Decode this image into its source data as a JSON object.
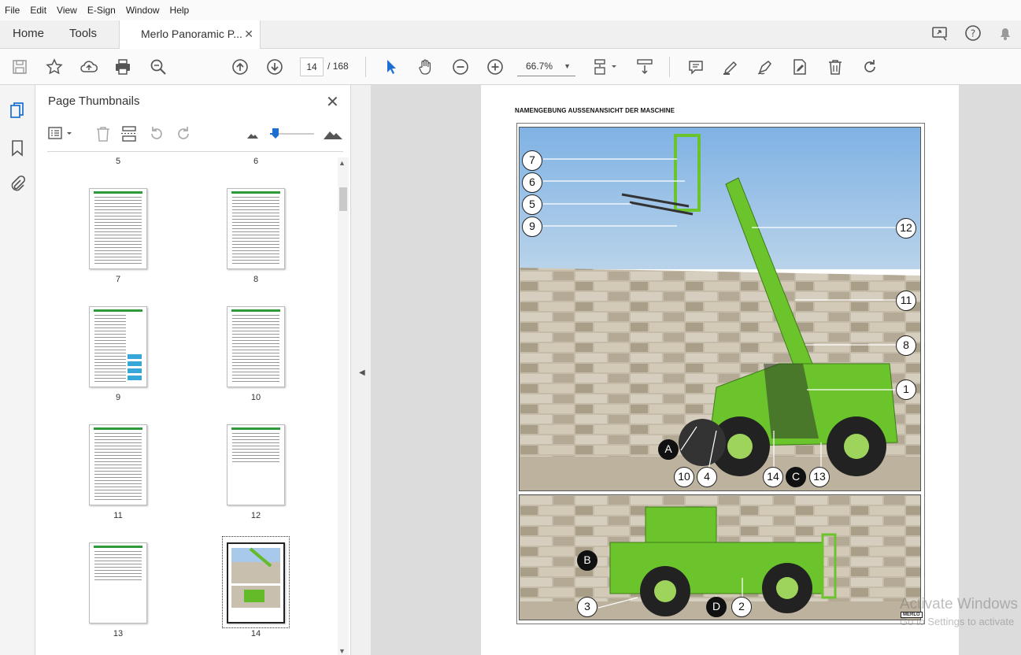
{
  "menu": [
    "File",
    "Edit",
    "View",
    "E-Sign",
    "Window",
    "Help"
  ],
  "nav": {
    "home": "Home",
    "tools": "Tools",
    "doc_tab": "Merlo Panoramic P...",
    "close": "✕"
  },
  "toolbar": {
    "current_page": "14",
    "page_sep": "/",
    "total_pages": "168",
    "zoom": "66.7%",
    "zoom_caret": "▼"
  },
  "panel": {
    "title": "Page Thumbnails",
    "close": "✕",
    "thumbnails": [
      {
        "label": "5"
      },
      {
        "label": "6"
      },
      {
        "label": "7"
      },
      {
        "label": "8"
      },
      {
        "label": "9"
      },
      {
        "label": "10"
      },
      {
        "label": "11"
      },
      {
        "label": "12"
      },
      {
        "label": "13"
      },
      {
        "label": "14",
        "selected": true
      }
    ]
  },
  "document": {
    "heading": "NAMENGEBUNG AUSSENANSICHT DER MASCHINE",
    "callouts_top": [
      "7",
      "6",
      "5",
      "9",
      "12",
      "11",
      "8",
      "1",
      "A",
      "10",
      "4",
      "14",
      "C",
      "13"
    ],
    "callouts_bottom": [
      "B",
      "3",
      "D",
      "2"
    ],
    "logo": "MERLO"
  },
  "watermark": {
    "line1": "Activate Windows",
    "line2": "Go to Settings to activate"
  },
  "colors": {
    "machine_green": "#6cc42c",
    "sky": "#9ec3e8",
    "stone": "#c9c0ad",
    "accent_blue": "#1a6fd1"
  }
}
